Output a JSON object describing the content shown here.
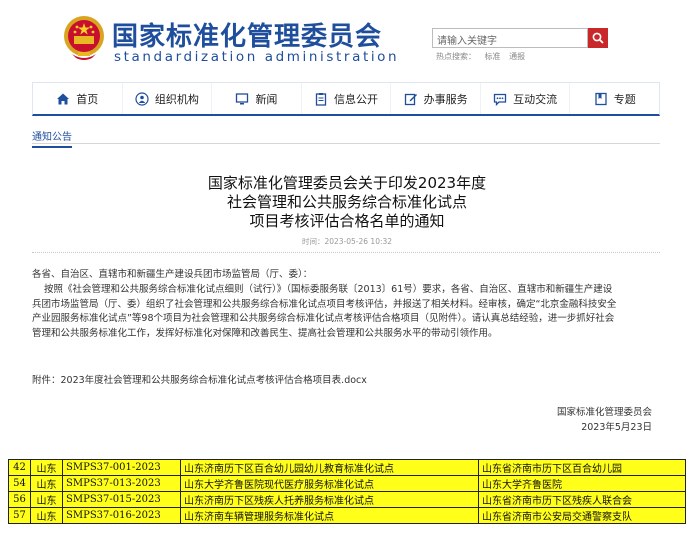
{
  "header": {
    "site_title": "国家标准化管理委员会",
    "site_subtitle": "standardization administration",
    "search_placeholder": "请输入关键字",
    "hot_words_label": "热点搜索：",
    "hot_words": [
      "标准",
      "通报"
    ]
  },
  "nav": {
    "items": [
      {
        "label": "首页",
        "icon": "home-icon"
      },
      {
        "label": "组织机构",
        "icon": "people-icon"
      },
      {
        "label": "新闻",
        "icon": "monitor-icon"
      },
      {
        "label": "信息公开",
        "icon": "clipboard-icon"
      },
      {
        "label": "办事服务",
        "icon": "edit-icon"
      },
      {
        "label": "互动交流",
        "icon": "chat-icon"
      },
      {
        "label": "专题",
        "icon": "bookmark-icon"
      }
    ]
  },
  "breadcrumb": "通知公告",
  "article": {
    "title_line1": "国家标准化管理委员会关于印发2023年度",
    "title_line2": "社会管理和公共服务综合标准化试点",
    "title_line3": "项目考核评估合格名单的通知",
    "date": "时间：2023-05-26 10:32",
    "salutation": "各省、自治区、直辖市和新疆生产建设兵团市场监管局（厅、委）：",
    "body_line1": "按照《社会管理和公共服务综合标准化试点细则（试行）》（国标委服务联〔2013〕61号）要求，各省、自治区、直辖市和新疆生产建设",
    "body_line2": "兵团市场监管局（厅、委）组织了社会管理和公共服务综合标准化试点项目考核评估，并报送了相关材料。经审核，确定“北京金融科技安全",
    "body_line3": "产业园服务标准化试点”等98个项目为社会管理和公共服务综合标准化试点考核评估合格项目（见附件）。请认真总结经验，进一步抓好社会",
    "body_line4": "管理和公共服务标准化工作，发挥好标准化对保障和改善民生、提高社会管理和公共服务水平的带动引领作用。",
    "attachment": "附件：2023年度社会管理和公共服务综合标准化试点考核评估合格项目表.docx",
    "signature": "国家标准化管理委员会",
    "sign_date": "2023年5月23日"
  },
  "table": {
    "rows": [
      {
        "no": "42",
        "province": "山东",
        "code": "SMPS37-001-2023",
        "name": "山东济南历下区百合幼儿园幼儿教育标准化试点",
        "org": "山东省济南市历下区百合幼儿园"
      },
      {
        "no": "54",
        "province": "山东",
        "code": "SMPS37-013-2023",
        "name": "山东大学齐鲁医院现代医疗服务标准化试点",
        "org": "山东大学齐鲁医院"
      },
      {
        "no": "56",
        "province": "山东",
        "code": "SMPS37-015-2023",
        "name": "山东济南历下区残疾人托养服务标准化试点",
        "org": "山东省济南市历下区残疾人联合会"
      },
      {
        "no": "57",
        "province": "山东",
        "code": "SMPS37-016-2023",
        "name": "山东济南车辆管理服务标准化试点",
        "org": "山东省济南市公安局交通警察支队"
      }
    ]
  },
  "colors": {
    "brand_blue": "#1f4e9c",
    "search_red": "#c9282b",
    "highlight_yellow": "#ffff1a"
  }
}
